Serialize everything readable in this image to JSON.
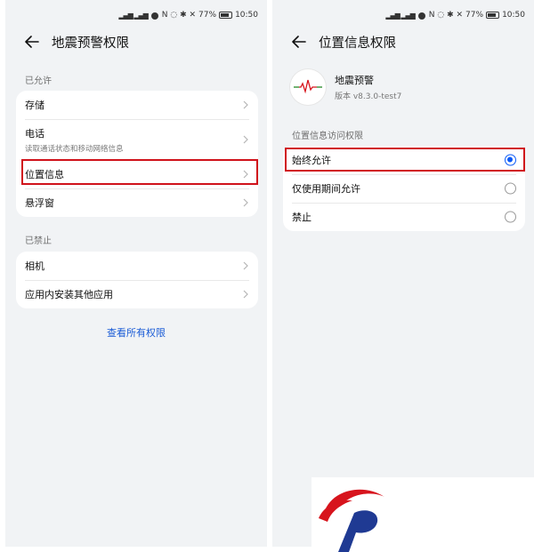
{
  "status_bar": {
    "battery": "77%",
    "time": "10:50"
  },
  "left_screen": {
    "title": "地震预警权限",
    "allowed_section": "已允许",
    "allowed_items": [
      {
        "label": "存储"
      },
      {
        "label": "电话",
        "sublabel": "读取通话状态和移动网络信息"
      },
      {
        "label": "位置信息"
      },
      {
        "label": "悬浮窗"
      }
    ],
    "denied_section": "已禁止",
    "denied_items": [
      {
        "label": "相机"
      },
      {
        "label": "应用内安装其他应用"
      }
    ],
    "view_all_link": "查看所有权限"
  },
  "right_screen": {
    "title": "位置信息权限",
    "app_name": "地震预警",
    "app_version": "版本 v8.3.0-test7",
    "section": "位置信息访问权限",
    "options": [
      {
        "label": "始终允许",
        "selected": true
      },
      {
        "label": "仅使用期间允许",
        "selected": false
      },
      {
        "label": "禁止",
        "selected": false
      }
    ]
  },
  "colors": {
    "accent": "#0a59f7",
    "highlight": "#d0121b",
    "link": "#1a5bd6",
    "logo_red": "#d7141d",
    "logo_blue": "#1f3a93"
  },
  "icons": [
    "back-arrow-icon",
    "chevron-right-icon",
    "radio-button-icon",
    "earthquake-wave-logo-icon",
    "wifi-icon",
    "signal-icon",
    "battery-icon"
  ]
}
